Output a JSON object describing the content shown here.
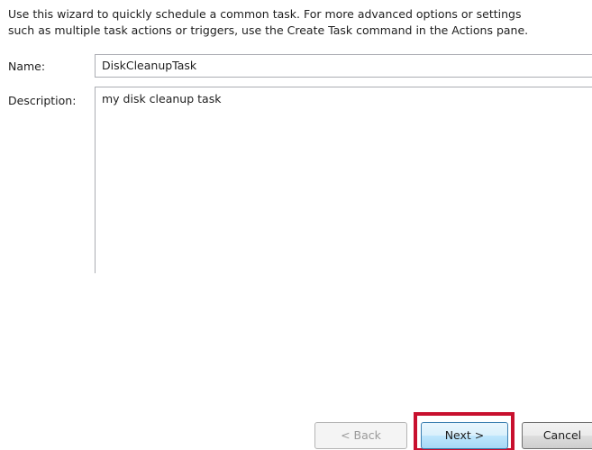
{
  "wizard": {
    "intro_text": "Use this wizard to quickly schedule a common task.  For more advanced options or settings\nsuch as multiple task actions or triggers, use the Create Task command in the Actions pane."
  },
  "form": {
    "name_label": "Name:",
    "name_value": "DiskCleanupTask",
    "description_label": "Description:",
    "description_value": "my disk cleanup task"
  },
  "buttons": {
    "back_label": "< Back",
    "next_label": "Next >",
    "cancel_label": "Cancel"
  },
  "colors": {
    "highlight": "#c8102e",
    "input_border": "#abadb3"
  }
}
